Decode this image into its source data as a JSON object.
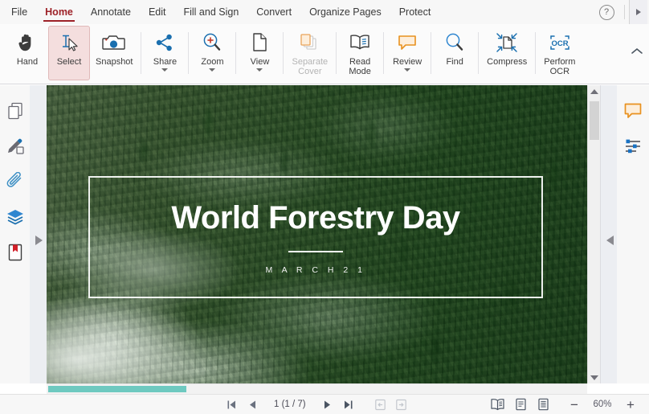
{
  "menu": {
    "items": [
      {
        "label": "File",
        "active": false
      },
      {
        "label": "Home",
        "active": true
      },
      {
        "label": "Annotate",
        "active": false
      },
      {
        "label": "Edit",
        "active": false
      },
      {
        "label": "Fill and Sign",
        "active": false
      },
      {
        "label": "Convert",
        "active": false
      },
      {
        "label": "Organize Pages",
        "active": false
      },
      {
        "label": "Protect",
        "active": false
      }
    ],
    "help_glyph": "?",
    "accent_color": "#9d2228"
  },
  "ribbon": {
    "buttons": [
      {
        "label": "Hand",
        "icon": "hand-icon",
        "state": "normal",
        "caret": false
      },
      {
        "label": "Select",
        "icon": "select-icon",
        "state": "active",
        "caret": false
      },
      {
        "label": "Snapshot",
        "icon": "snapshot-icon",
        "state": "normal",
        "caret": false
      },
      {
        "label": "Share",
        "icon": "share-icon",
        "state": "normal",
        "caret": true
      },
      {
        "label": "Zoom",
        "icon": "zoom-in-icon",
        "state": "normal",
        "caret": true
      },
      {
        "label": "View",
        "icon": "page-view-icon",
        "state": "normal",
        "caret": true
      },
      {
        "label": "Separate\nCover",
        "icon": "separate-cover-icon",
        "state": "disabled",
        "caret": false
      },
      {
        "label": "Read\nMode",
        "icon": "read-mode-icon",
        "state": "normal",
        "caret": false
      },
      {
        "label": "Review",
        "icon": "review-comment-icon",
        "state": "normal",
        "caret": true
      },
      {
        "label": "Find",
        "icon": "find-magnifier-icon",
        "state": "normal",
        "caret": false
      },
      {
        "label": "Compress",
        "icon": "compress-icon",
        "state": "normal",
        "caret": false
      },
      {
        "label": "Perform\nOCR",
        "icon": "ocr-icon",
        "state": "normal",
        "caret": false
      }
    ],
    "collapse_icon": "chevron-up-icon",
    "active_bg": "#f4dede"
  },
  "left_rail": {
    "items": [
      {
        "icon": "pages-thumbnail-icon",
        "name": "page-thumbnails"
      },
      {
        "icon": "stamp-icon",
        "name": "stamps"
      },
      {
        "icon": "attachment-paperclip-icon",
        "name": "attachments"
      },
      {
        "icon": "layers-icon",
        "name": "layers"
      },
      {
        "icon": "bookmark-icon",
        "name": "bookmarks"
      }
    ],
    "expander_icon": "triangle-right-icon"
  },
  "right_rail": {
    "items": [
      {
        "icon": "comment-bubble-icon",
        "name": "comments-panel",
        "color": "#e8911f"
      },
      {
        "icon": "properties-sliders-icon",
        "name": "properties-panel",
        "color": "#1a73c4"
      }
    ],
    "expander_icon": "triangle-left-icon"
  },
  "document": {
    "title": "World Forestry Day",
    "subtitle": "M A R C H   2 1"
  },
  "statusbar": {
    "first_page_icon": "first-page-icon",
    "prev_page_icon": "previous-page-icon",
    "page_indicator": "1 (1 / 7)",
    "next_page_icon": "next-page-icon",
    "last_page_icon": "last-page-icon",
    "back_view_icon": "go-back-view-icon",
    "forward_view_icon": "go-forward-view-icon",
    "view_modes": [
      {
        "icon": "facing-pages-icon",
        "name": "facing-page-view"
      },
      {
        "icon": "single-page-icon",
        "name": "single-page-view"
      },
      {
        "icon": "continuous-scroll-icon",
        "name": "continuous-view"
      }
    ],
    "zoom_out_label": "−",
    "zoom_level": "60%",
    "zoom_in_label": "+"
  }
}
